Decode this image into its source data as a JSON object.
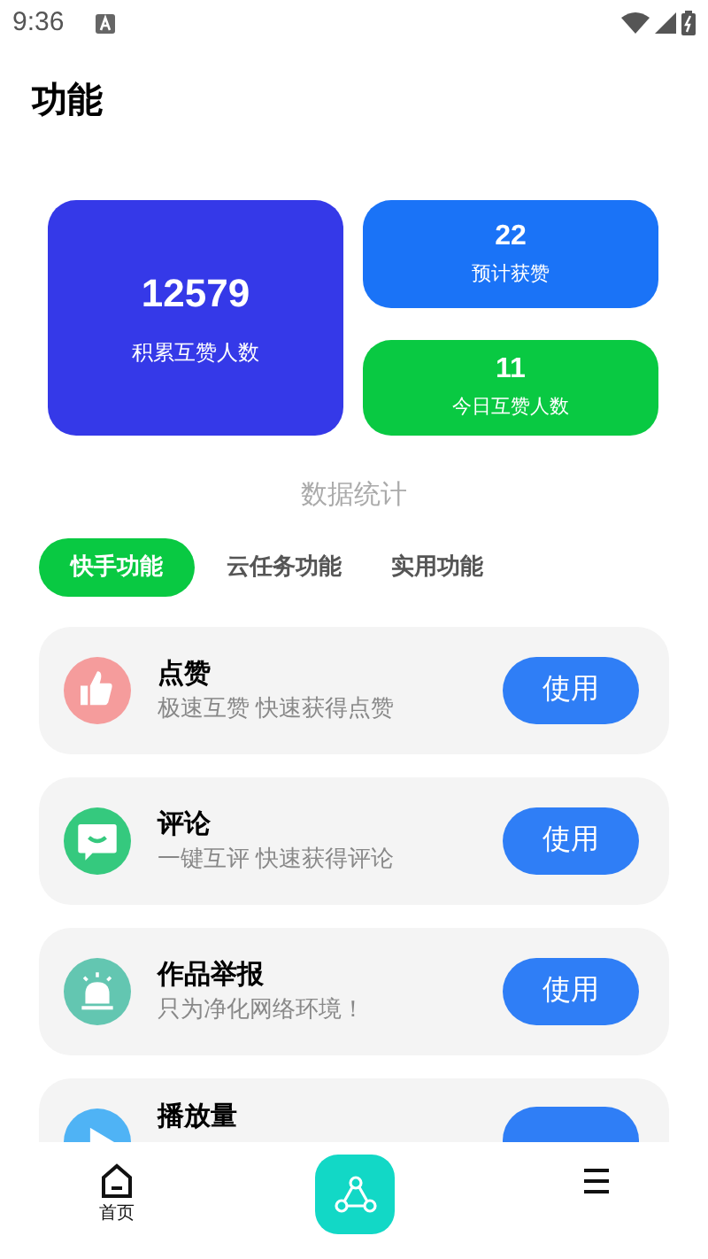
{
  "status_bar": {
    "time": "9:36"
  },
  "title": "功能",
  "stats": [
    {
      "value": "12579",
      "label": "积累互赞人数",
      "color": "#3539e8"
    },
    {
      "value": "22",
      "label": "预计获赞",
      "color": "#1a73f7"
    },
    {
      "value": "11",
      "label": "今日互赞人数",
      "color": "#09c942"
    }
  ],
  "stats_caption": "数据统计",
  "tabs": [
    {
      "label": "快手功能",
      "selected": true
    },
    {
      "label": "云任务功能",
      "selected": false
    },
    {
      "label": "实用功能",
      "selected": false
    }
  ],
  "features": [
    {
      "kind": "like",
      "title": "点赞",
      "subtitle": "极速互赞 快速获得点赞",
      "button": "使用",
      "color": "#f59c9c"
    },
    {
      "kind": "comment",
      "title": "评论",
      "subtitle": "一键互评 快速获得评论",
      "button": "使用",
      "color": "#35c97e"
    },
    {
      "kind": "report",
      "title": "作品举报",
      "subtitle": "只为净化网络环境！",
      "button": "使用",
      "color": "#63c6b1"
    },
    {
      "kind": "play",
      "title": "播放量",
      "color": "#4fb3f5"
    }
  ],
  "bottom_nav": [
    {
      "kind": "home",
      "label": "首页",
      "selected": true
    },
    {
      "kind": "share"
    },
    {
      "kind": "list"
    }
  ]
}
